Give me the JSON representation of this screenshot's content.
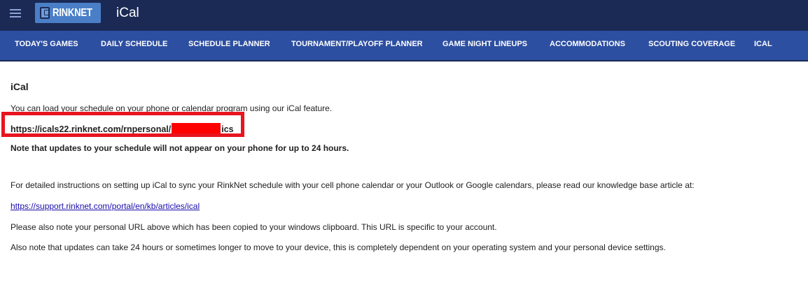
{
  "header": {
    "menu_icon": "hamburger-menu-icon",
    "logo_text": "RINKNET",
    "title": "iCal"
  },
  "nav": {
    "items": [
      {
        "label": "TODAY'S GAMES"
      },
      {
        "label": "DAILY SCHEDULE"
      },
      {
        "label": "SCHEDULE PLANNER"
      },
      {
        "label": "TOURNAMENT/PLAYOFF PLANNER"
      },
      {
        "label": "GAME NIGHT LINEUPS"
      },
      {
        "label": "ACCOMMODATIONS"
      },
      {
        "label": "SCOUTING COVERAGE"
      },
      {
        "label": "ICAL"
      }
    ]
  },
  "main": {
    "heading": "iCal",
    "intro": "You can load your schedule on your phone or calendar program using our iCal feature.",
    "url_prefix": "https://icals22.rinknet.com/rnpersonal/",
    "url_suffix": "ics",
    "update_note": "Note that updates to your schedule will not appear on your phone for up to 24 hours.",
    "instructions": "For detailed instructions on setting up iCal to sync your RinkNet schedule with your cell phone calendar or your Outlook or Google calendars, please read our knowledge base article at:",
    "kb_link": "https://support.rinknet.com/portal/en/kb/articles/ical",
    "clipboard_note": "Please also note your personal URL above which has been copied to your windows clipboard. This URL is specific to your account.",
    "device_note": "Also note that updates can take 24 hours or sometimes longer to move to your device, this is completely dependent on your operating system and your personal device settings."
  },
  "colors": {
    "topbar": "#1a2a55",
    "navbar": "#2d4fa1",
    "logo_bg": "#4a7fc8",
    "highlight": "#e8141f",
    "redaction": "#ff0000"
  }
}
